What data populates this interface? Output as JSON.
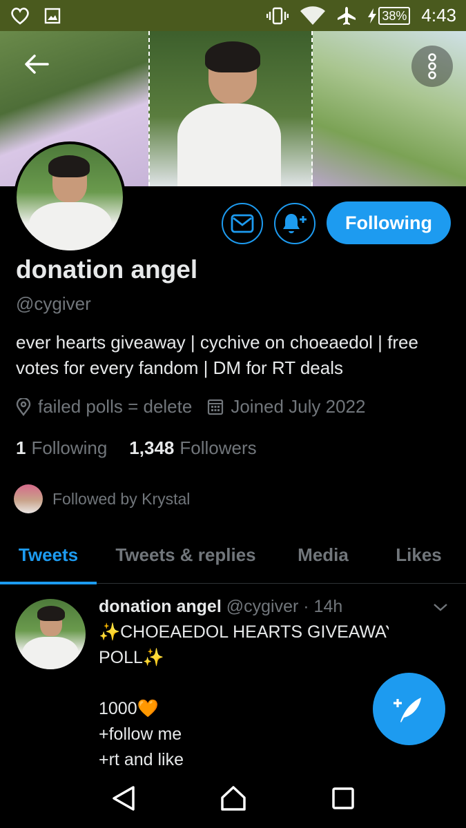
{
  "status_bar": {
    "battery": "38%",
    "time": "4:43"
  },
  "profile": {
    "name": "donation angel",
    "handle": "@cygiver",
    "bio_line1": "ever hearts giveaway | cychive on choeaedol | free",
    "bio_line2": "votes for every fandom | DM for RT deals",
    "location": "failed polls = delete",
    "joined": "Joined July 2022",
    "following_count": "1",
    "following_label": "Following",
    "followers_count": "1,348",
    "followers_label": "Followers",
    "followed_by": "Followed by Krystal",
    "follow_button": "Following"
  },
  "tabs": [
    {
      "label": "Tweets",
      "active": true
    },
    {
      "label": "Tweets & replies",
      "active": false
    },
    {
      "label": "Media",
      "active": false
    },
    {
      "label": "Likes",
      "active": false
    }
  ],
  "tweet": {
    "author": "donation angel",
    "handle": "@cygiver",
    "time": "· 14h",
    "line1": "✨CHOEAEDOL HEARTS GIVEAWAY",
    "line2": "POLL✨",
    "line3": "1000🧡",
    "line4": "+follow me",
    "line5": "+rt and like"
  },
  "colors": {
    "accent": "#1d9bf0",
    "background": "#000000",
    "muted_text": "#71767b",
    "status_bar": "#4a5a1e"
  },
  "icons": [
    "back-arrow-icon",
    "more-vertical-icon",
    "mail-icon",
    "bell-plus-icon",
    "location-pin-icon",
    "calendar-icon",
    "chevron-down-icon",
    "compose-feather-icon",
    "nav-back-icon",
    "nav-home-icon",
    "nav-recents-icon"
  ]
}
